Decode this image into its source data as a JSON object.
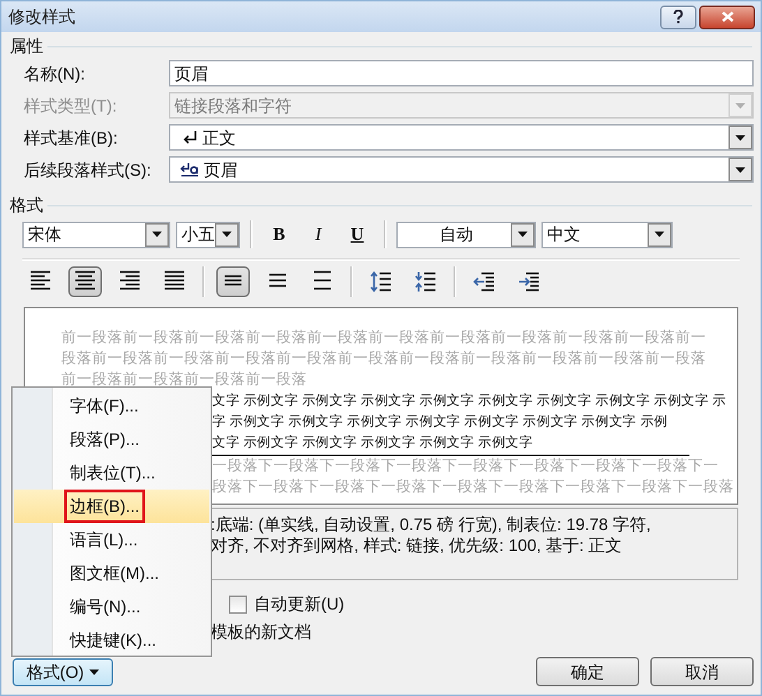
{
  "window": {
    "title": "修改样式",
    "controls": [
      {
        "kind": "help"
      },
      {
        "kind": "close"
      }
    ]
  },
  "properties": {
    "heading": "属性",
    "rows": [
      {
        "label": "名称(N):",
        "value": "页眉",
        "kind": "text",
        "disabled": false
      },
      {
        "label": "样式类型(T):",
        "value": "链接段落和字符",
        "kind": "dropdown",
        "disabled": true
      },
      {
        "label": "样式基准(B):",
        "value": "正文",
        "kind": "paragraph-style-dropdown",
        "disabled": false
      },
      {
        "label": "后续段落样式(S):",
        "value": "页眉",
        "kind": "linked-style-dropdown",
        "disabled": false
      }
    ]
  },
  "format": {
    "heading": "格式",
    "font": "宋体",
    "size": "小五",
    "color_setting": "自动",
    "language": "中文",
    "font_buttons": [
      {
        "text": "B",
        "kind": "bold",
        "selected": false
      },
      {
        "text": "I",
        "kind": "italic",
        "selected": false
      },
      {
        "text": "U",
        "kind": "underline",
        "selected": false
      }
    ],
    "paragraph_buttons": [
      {
        "kind": "align-left",
        "selected": false
      },
      {
        "kind": "align-center",
        "selected": true
      },
      {
        "kind": "align-right",
        "selected": false
      },
      {
        "kind": "justify",
        "selected": false
      },
      {
        "kind": "separator"
      },
      {
        "kind": "single-spacing",
        "selected": true
      },
      {
        "kind": "one-half-spacing",
        "selected": false
      },
      {
        "kind": "double-spacing",
        "selected": false
      },
      {
        "kind": "separator"
      },
      {
        "kind": "increase-space",
        "selected": false
      },
      {
        "kind": "decrease-space",
        "selected": false
      },
      {
        "kind": "separator"
      },
      {
        "kind": "decrease-indent",
        "selected": false
      },
      {
        "kind": "increase-indent",
        "selected": false
      }
    ]
  },
  "preview": {
    "preceding_lines": [
      "前一段落前一段落前一段落前一段落前一段落前一段落前一段落前一段落前一段落前一段落前一",
      "段落前一段落前一段落前一段落前一段落前一段落前一段落前一段落前一段落前一段落前一段落",
      "前一段落前一段落前一段落前一段落"
    ],
    "sample_lines": [
      "文字 示例文字 示例文字 示例文字 示例文字 示例文字 示例文字 示例文字 示例文字 示",
      "字 示例文字 示例文字 示例文字 示例文字 示例文字 示例文字 示例文字 示例",
      "文字 示例文字 示例文字 示例文字 示例文字 示例文字"
    ],
    "following_lines": [
      "一段落下一段落下一段落下一段落下一段落下一段落下一段落下一段落下一",
      "段落下一段落下一段落下一段落下一段落下一段落下一段落下一段落下一段落"
    ]
  },
  "description_lines": [
    ":底端: (单实线, 自动设置, 0.75 磅 行宽), 制表位: 19.78 字符,",
    "对齐, 不对齐到网格, 样式: 链接, 优先级: 100, 基于: 正文"
  ],
  "options": [
    {
      "kind": "checkbox",
      "label": "自动更新(U)",
      "checked": false
    },
    {
      "kind": "text",
      "label": "模板的新文档"
    }
  ],
  "format_button": "格式(O)",
  "buttons": [
    "确定",
    "取消"
  ],
  "format_menu": [
    {
      "label": "字体(F)...",
      "selected": false,
      "outlined": false
    },
    {
      "label": "段落(P)...",
      "selected": false,
      "outlined": false
    },
    {
      "label": "制表位(T)...",
      "selected": false,
      "outlined": false
    },
    {
      "label": "边框(B)...",
      "selected": true,
      "outlined": true
    },
    {
      "label": "语言(L)...",
      "selected": false,
      "outlined": false
    },
    {
      "label": "图文框(M)...",
      "selected": false,
      "outlined": false
    },
    {
      "label": "编号(N)...",
      "selected": false,
      "outlined": false
    },
    {
      "label": "快捷键(K)...",
      "selected": false,
      "outlined": false
    }
  ]
}
